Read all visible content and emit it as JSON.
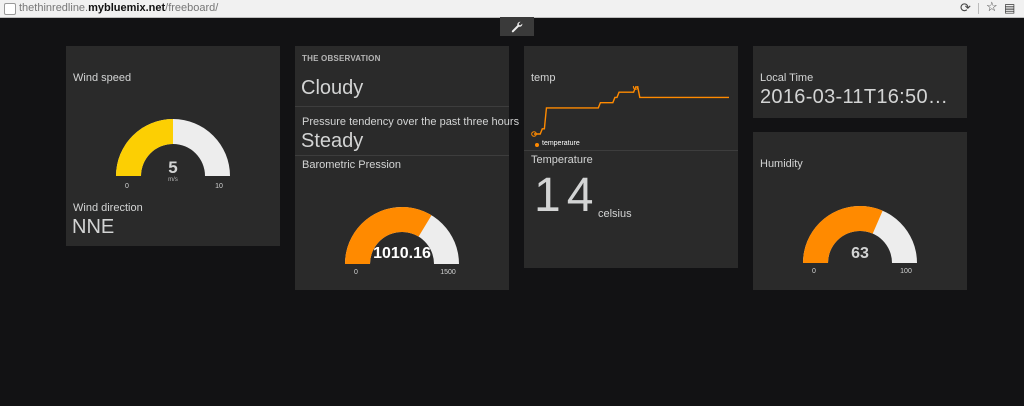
{
  "browser": {
    "url_prefix": "thethinredline.",
    "url_host": "mybluemix.net",
    "url_path": "/freeboard/"
  },
  "toolbar": {
    "wrench_glyph": "🔧"
  },
  "colors": {
    "background": "#121214",
    "pane": "#2a2a2a",
    "gauge_empty": "#ededed",
    "wind_fill": "#fccf03",
    "orange_fill": "#ff8a00"
  },
  "wind": {
    "speed_title": "Wind speed",
    "value": "5",
    "unit": "m/s",
    "min": "0",
    "max": "10",
    "fraction": 0.5,
    "direction_title": "Wind direction",
    "direction_value": "NNE"
  },
  "observation": {
    "header": "THE OBSERVATION",
    "condition": "Cloudy",
    "tendency_title": "Pressure tendency over the past three hours",
    "tendency_value": "Steady",
    "pressure_title": "Barometric Pression",
    "pressure_value": "1010.16",
    "pressure_min": "0",
    "pressure_max": "1500",
    "pressure_fraction": 0.6734
  },
  "temp_chart": {
    "title": "temp",
    "legend": "temperature",
    "chart_data": {
      "type": "line",
      "series": [
        {
          "name": "temperature",
          "values": [
            0,
            0,
            0,
            0,
            1,
            1,
            5,
            5,
            5,
            5,
            5,
            5,
            5,
            5,
            5,
            5,
            5,
            5,
            5,
            5,
            5,
            5,
            5,
            5,
            5,
            5,
            5,
            5,
            5,
            5,
            5,
            5,
            6,
            6,
            6,
            6,
            6,
            6,
            6,
            7,
            7,
            8,
            8,
            8,
            8,
            8,
            8,
            8,
            8,
            9,
            9,
            7,
            7,
            7,
            7,
            7,
            7,
            7,
            7,
            7,
            7,
            7,
            7,
            7,
            7,
            7,
            7,
            7,
            7,
            7,
            7,
            7,
            7,
            7,
            7,
            7,
            7,
            7,
            7,
            7,
            7,
            7,
            7,
            7,
            7,
            7,
            7,
            7,
            7,
            7,
            7,
            7,
            7,
            7,
            7
          ]
        }
      ]
    },
    "temperature_title": "Temperature",
    "temperature_value": "14",
    "temperature_unit": "celsius"
  },
  "local_time": {
    "title": "Local Time",
    "value": "2016-03-11T16:50…"
  },
  "humidity": {
    "title": "Humidity",
    "value": "63",
    "min": "0",
    "max": "100",
    "fraction": 0.63
  }
}
